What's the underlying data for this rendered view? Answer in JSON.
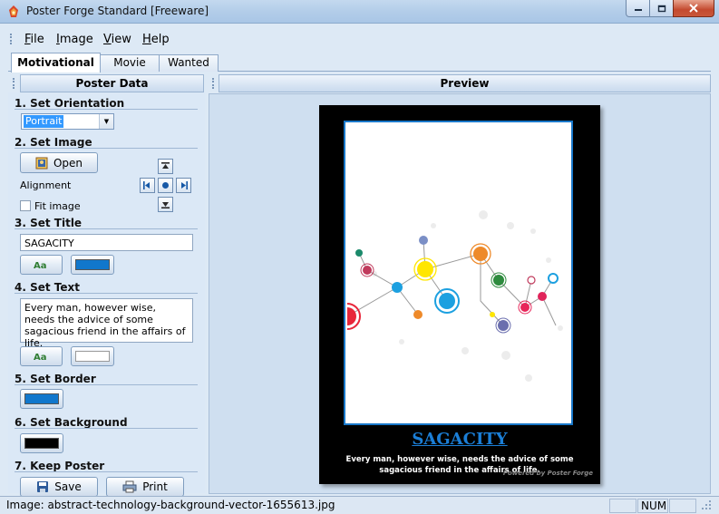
{
  "window": {
    "title": "Poster Forge Standard [Freeware]"
  },
  "menu": {
    "file": "File",
    "image": "Image",
    "view": "View",
    "help": "Help"
  },
  "tabs": [
    {
      "label": "Motivational"
    },
    {
      "label": "Movie"
    },
    {
      "label": "Wanted"
    }
  ],
  "left_panel": {
    "header": "Poster Data",
    "orientation": {
      "title": "1. Set Orientation",
      "value": "Portrait"
    },
    "image": {
      "title": "2. Set Image",
      "open_label": "Open",
      "alignment_label": "Alignment",
      "fit_label": "Fit image",
      "fit_checked": false
    },
    "title_section": {
      "title": "3. Set Title",
      "value": "SAGACITY",
      "color": "#1177cc"
    },
    "text_section": {
      "title": "4. Set Text",
      "value": "Every man, however wise, needs the advice of some sagacious friend in the affairs of life.",
      "color": "#ffffff"
    },
    "border": {
      "title": "5. Set Border",
      "color": "#1177cc"
    },
    "background": {
      "title": "6. Set Background",
      "color": "#000000"
    },
    "keep": {
      "title": "7. Keep Poster",
      "save_label": "Save",
      "print_label": "Print"
    }
  },
  "preview": {
    "header": "Preview",
    "poster_title": "SAGACITY",
    "poster_text": "Every man, however wise, needs the advice of some sagacious friend in the affairs of life.",
    "brand": "Powered by Poster Forge"
  },
  "status": {
    "image": "Image: abstract-technology-background-vector-1655613.jpg",
    "num": "NUM"
  }
}
